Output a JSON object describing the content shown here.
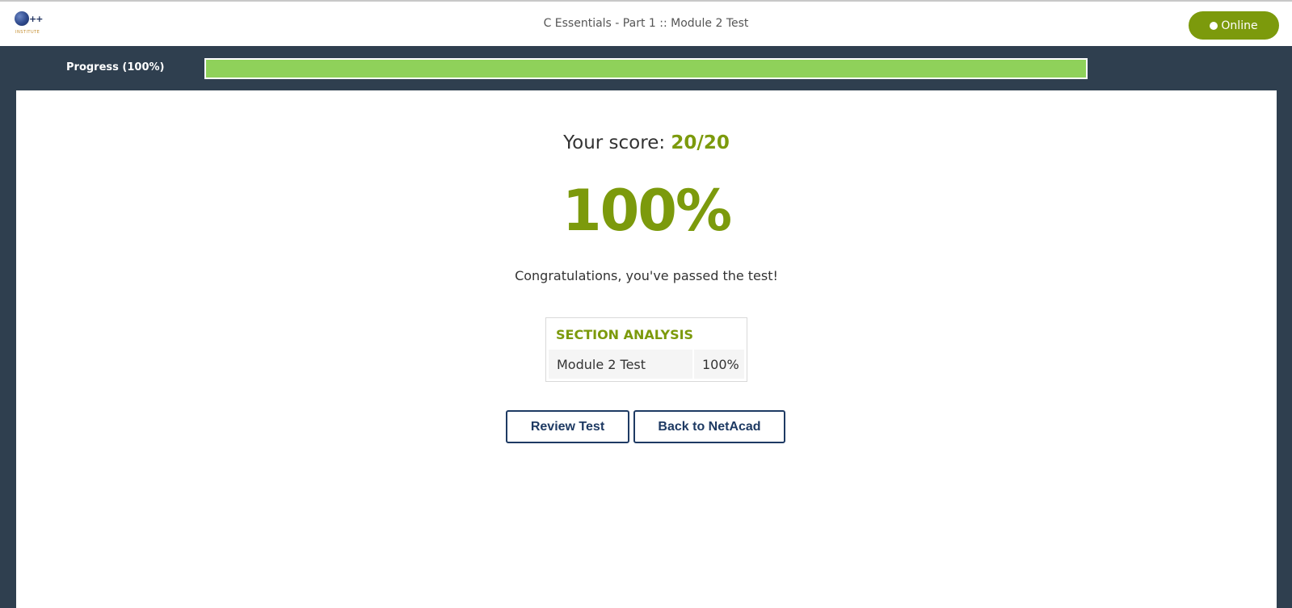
{
  "header": {
    "logo": {
      "icon": "cpp-institute-logo",
      "mark": "++",
      "wordmark": "INSTITUTE"
    },
    "title": "C Essentials - Part 1 :: Module 2 Test",
    "status_button": {
      "label": "Online",
      "icon": "status-dot-icon",
      "color": "#7c9a0c"
    }
  },
  "progress": {
    "label": "Progress (100%)",
    "value_percent": 100,
    "fill_color": "#8fd15a"
  },
  "result": {
    "score_prefix": "Your score: ",
    "score_value": "20/20",
    "percent": "100%",
    "message": "Congratulations, you've passed the test!",
    "accent_color": "#7c9a0c"
  },
  "section_analysis": {
    "heading": "SECTION ANALYSIS",
    "rows": [
      {
        "name": "Module 2 Test",
        "value": "100%"
      }
    ]
  },
  "actions": {
    "review_label": "Review Test",
    "back_label": "Back to NetAcad"
  }
}
